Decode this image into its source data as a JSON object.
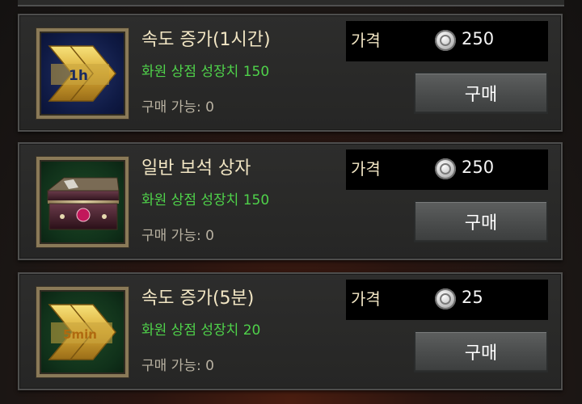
{
  "items": [
    {
      "title": "속도 증가(1시간)",
      "growth": "화원 상점 성장치 150",
      "availability": "구매 가능: 0",
      "price_label": "가격",
      "price": "250",
      "buy_label": "구매",
      "icon": "speedup-arrow-icon",
      "badge": "1h"
    },
    {
      "title": "일반 보석 상자",
      "growth": "화원 상점 성장치 150",
      "availability": "구매 가능: 0",
      "price_label": "가격",
      "price": "250",
      "buy_label": "구매",
      "icon": "gem-chest-icon"
    },
    {
      "title": "속도 증가(5분)",
      "growth": "화원 상점 성장치 20",
      "availability": "구매 가능: 0",
      "price_label": "가격",
      "price": "25",
      "buy_label": "구매",
      "icon": "speedup-arrow-icon",
      "badge": "5min"
    }
  ],
  "colors": {
    "title": "#f2e6c4",
    "growth": "#4fd24a",
    "availability": "#b9b2a2",
    "price_box": "#000000",
    "button": "#4a4c4c"
  }
}
